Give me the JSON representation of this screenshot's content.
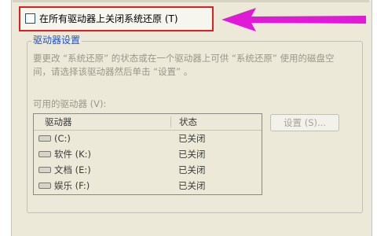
{
  "checkbox": {
    "label": "在所有驱动器上关闭系统还原 (T)",
    "checked": false
  },
  "group": {
    "title": "驱动器设置",
    "description": "要更改 “系统还原” 的状态或在一个驱动器上可供 “系统还原” 使用的磁盘空间，请选择该驱动器然后单击 “设置” 。",
    "available_label": "可用的驱动器 (V):"
  },
  "list": {
    "headers": {
      "drive": "驱动器",
      "status": "状态"
    },
    "rows": [
      {
        "drive": "(C:)",
        "status": "已关闭"
      },
      {
        "drive": "软件  (K:)",
        "status": "已关闭"
      },
      {
        "drive": "文档  (E:)",
        "status": "已关闭"
      },
      {
        "drive": "娱乐  (F:)",
        "status": "已关闭"
      }
    ]
  },
  "settings_button": {
    "label": "设置 (S)..."
  },
  "colors": {
    "highlight": "#e02020",
    "arrow": "#e01bd8",
    "group_title": "#1e50c8"
  },
  "icons": {
    "arrow": "arrow-left-icon",
    "drive": "drive-icon"
  }
}
